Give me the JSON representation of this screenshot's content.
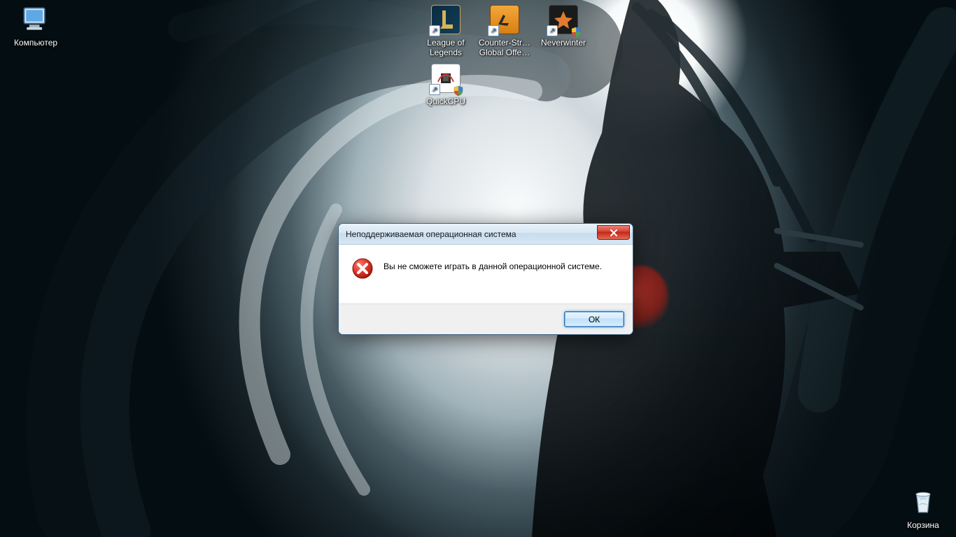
{
  "desktop": {
    "icons": {
      "computer": {
        "label": "Компьютер"
      },
      "lol": {
        "label": "League of Legends"
      },
      "csgo": {
        "label": "Counter-Str… Global Offe…"
      },
      "neverwinter": {
        "label": "Neverwinter"
      },
      "quickcpu": {
        "label": "QuickCPU"
      },
      "recycle": {
        "label": "Корзина"
      }
    }
  },
  "dialog": {
    "title": "Неподдерживаемая операционная система",
    "message": "Вы не сможете играть в данной операционной системе.",
    "ok_label": "ОК",
    "icon": "error-icon"
  }
}
